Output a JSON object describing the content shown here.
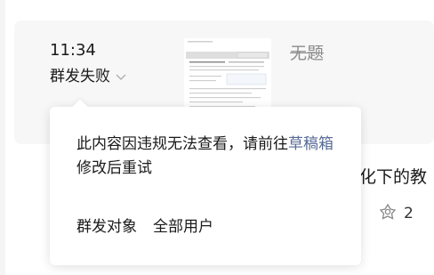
{
  "item": {
    "time": "11:34",
    "status": "群发失败",
    "title": "无题"
  },
  "next_item": {
    "title_fragment": "化下的教",
    "share_count": "2"
  },
  "popover": {
    "message_before": "此内容因违规无法查看，请前往",
    "link_text": "草稿箱",
    "message_after": "修改后重试",
    "target_label": "群发对象",
    "target_value": "全部用户"
  },
  "icons": {
    "status_toggle": "chevron-down-icon",
    "share": "share-flower-icon"
  },
  "colors": {
    "link": "#576b95",
    "card_bg": "#f7f7f7",
    "muted": "#8c8c8c"
  }
}
